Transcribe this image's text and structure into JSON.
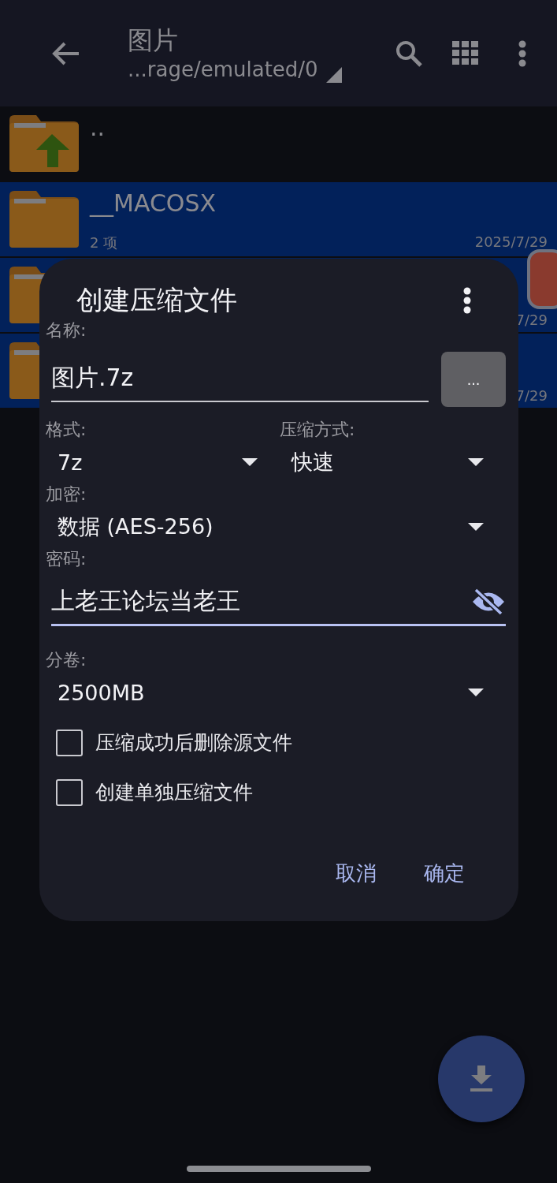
{
  "top_bar": {
    "title": "图片",
    "path": "...rage/emulated/0"
  },
  "files": [
    {
      "kind": "parent",
      "name": "..",
      "selected": false
    },
    {
      "kind": "folder",
      "name": "__MACOSX",
      "info": "2 项",
      "date": "2025/7/29",
      "selected": true
    },
    {
      "kind": "folder",
      "date": "7/29",
      "selected": true
    },
    {
      "kind": "folder",
      "date": "7/29",
      "selected": true
    }
  ],
  "dialog": {
    "title": "创建压缩文件",
    "name_label": "名称:",
    "name_value": "图片.7z",
    "browse_button": "...",
    "format_label": "格式:",
    "format_value": "7z",
    "method_label": "压缩方式:",
    "method_value": "快速",
    "encryption_label": "加密:",
    "encryption_value": "数据 (AES-256)",
    "password_label": "密码:",
    "password_value": "上老王论坛当老王",
    "split_label": "分卷:",
    "split_value": "2500MB",
    "options": [
      {
        "label": "压缩成功后删除源文件",
        "checked": false
      },
      {
        "label": "创建单独压缩文件",
        "checked": false
      }
    ],
    "buttons": [
      "取消",
      "确定"
    ]
  }
}
